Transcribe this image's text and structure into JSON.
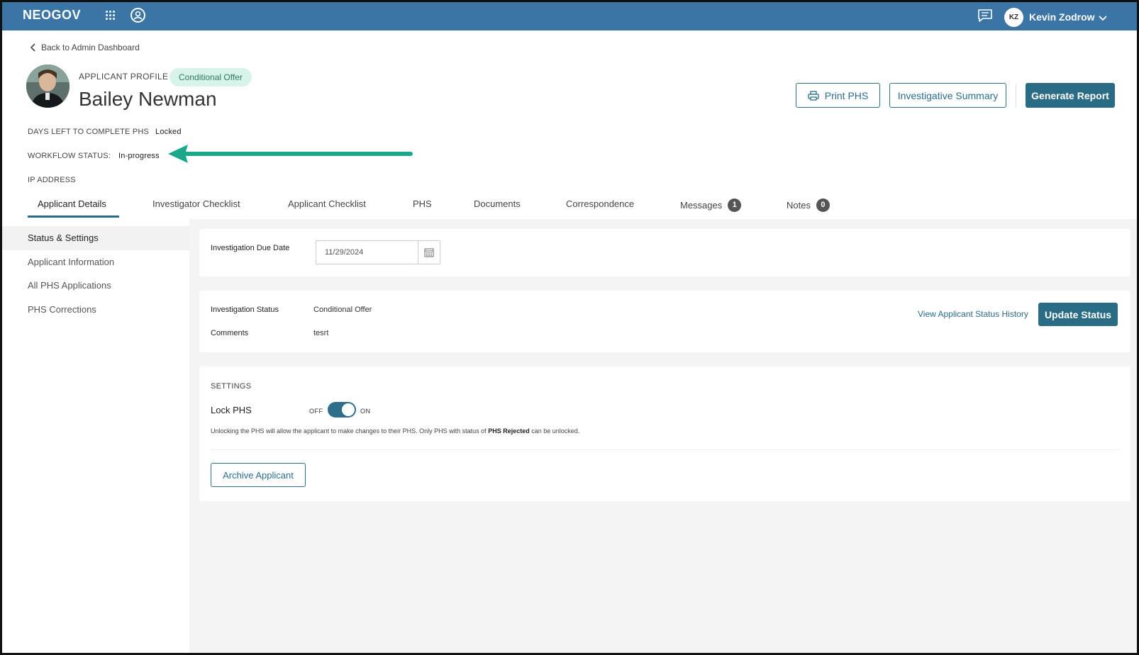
{
  "header": {
    "brand": "NEOGOV",
    "user_initials": "KZ",
    "user_name": "Kevin Zodrow"
  },
  "back_link": "Back to Admin Dashboard",
  "profile": {
    "label": "APPLICANT PROFILE",
    "status_badge": "Conditional Offer",
    "name": "Bailey Newman"
  },
  "actions": {
    "print": "Print PHS",
    "summary": "Investigative Summary",
    "report": "Generate Report"
  },
  "meta": {
    "days_label": "DAYS LEFT TO COMPLETE PHS",
    "days_value": "Locked",
    "workflow_label": "WORKFLOW STATUS:",
    "workflow_value": "In-progress",
    "ip_label": "IP ADDRESS"
  },
  "tabs": [
    {
      "label": "Applicant Details"
    },
    {
      "label": "Investigator Checklist"
    },
    {
      "label": "Applicant Checklist"
    },
    {
      "label": "PHS"
    },
    {
      "label": "Documents"
    },
    {
      "label": "Correspondence"
    },
    {
      "label": "Messages",
      "count": "1"
    },
    {
      "label": "Notes",
      "count": "0"
    }
  ],
  "sidenav": [
    {
      "label": "Status & Settings"
    },
    {
      "label": "Applicant Information"
    },
    {
      "label": "All PHS Applications"
    },
    {
      "label": "PHS Corrections"
    }
  ],
  "due_date": {
    "label": "Investigation Due Date",
    "value": "11/29/2024"
  },
  "status_card": {
    "status_label": "Investigation Status",
    "status_value": "Conditional Offer",
    "comments_label": "Comments",
    "comments_value": "tesrt",
    "history_link": "View Applicant Status History",
    "update_button": "Update Status"
  },
  "settings": {
    "title": "SETTINGS",
    "lock_label": "Lock PHS",
    "off_label": "OFF",
    "on_label": "ON",
    "lock_on": true,
    "help_prefix": "Unlocking the PHS will allow the applicant to make changes to their PHS. Only PHS with status of ",
    "help_bold": "PHS Rejected",
    "help_suffix": " can be unlocked.",
    "archive_button": "Archive Applicant"
  },
  "colors": {
    "topbar": "#3a75a6",
    "primary": "#2a6b85",
    "badge_bg": "#d8f3ea",
    "arrow": "#1aa88a"
  }
}
